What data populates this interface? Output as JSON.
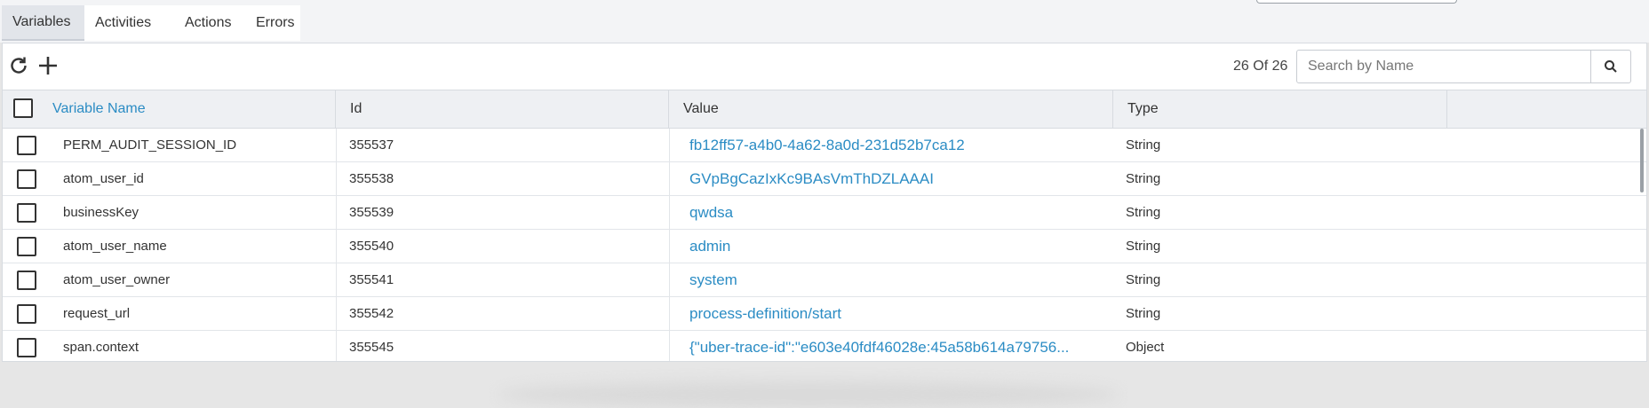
{
  "tabs": [
    {
      "label": "Variables",
      "active": true
    },
    {
      "label": "Activities",
      "active": false
    },
    {
      "label": "Actions",
      "active": false
    },
    {
      "label": "Errors",
      "active": false
    }
  ],
  "toolbar": {
    "refresh_icon": "refresh-icon",
    "add_icon": "plus-icon",
    "count": "26 Of 26",
    "search_placeholder": "Search by Name",
    "search_icon": "search-icon"
  },
  "columns": {
    "name": "Variable Name",
    "id": "Id",
    "value": "Value",
    "type": "Type"
  },
  "rows": [
    {
      "name": "PERM_AUDIT_SESSION_ID",
      "id": "355537",
      "value": "fb12ff57-a4b0-4a62-8a0d-231d52b7ca12",
      "type": "String"
    },
    {
      "name": "atom_user_id",
      "id": "355538",
      "value": "GVpBgCazIxKc9BAsVmThDZLAAAI",
      "type": "String"
    },
    {
      "name": "businessKey",
      "id": "355539",
      "value": "qwdsa",
      "type": "String"
    },
    {
      "name": "atom_user_name",
      "id": "355540",
      "value": "admin",
      "type": "String"
    },
    {
      "name": "atom_user_owner",
      "id": "355541",
      "value": "system",
      "type": "String"
    },
    {
      "name": "request_url",
      "id": "355542",
      "value": "process-definition/start",
      "type": "String"
    },
    {
      "name": "span.context",
      "id": "355545",
      "value": "{\"uber-trace-id\":\"e603e40fdf46028e:45a58b614a79756...",
      "type": "Object"
    }
  ],
  "colors": {
    "link": "#2b8cc4",
    "header_bg": "#eef0f3",
    "active_tab": "#e2e5ea"
  }
}
